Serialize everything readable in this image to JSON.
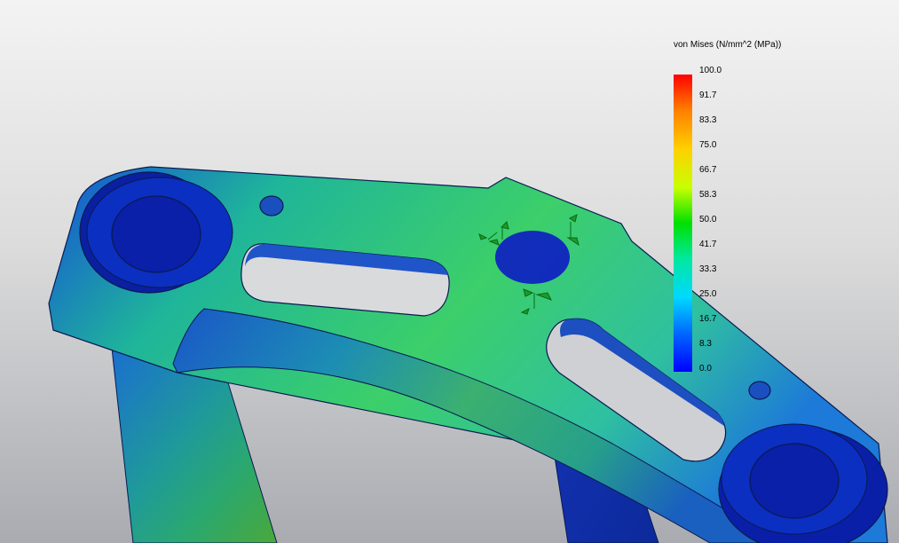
{
  "legend": {
    "title": "von Mises (N/mm^2 (MPa))",
    "ticks": [
      "100.0",
      "91.7",
      "83.3",
      "75.0",
      "66.7",
      "58.3",
      "50.0",
      "41.7",
      "33.3",
      "25.0",
      "16.7",
      "8.3",
      "0.0"
    ]
  },
  "colors": {
    "max_stress": "#ff0000",
    "high_stress": "#ffd000",
    "mid_stress": "#00e000",
    "low_stress": "#00d8ff",
    "min_stress": "#0000ff",
    "background_top": "#f3f3f3",
    "background_bottom": "#a9abb1"
  }
}
